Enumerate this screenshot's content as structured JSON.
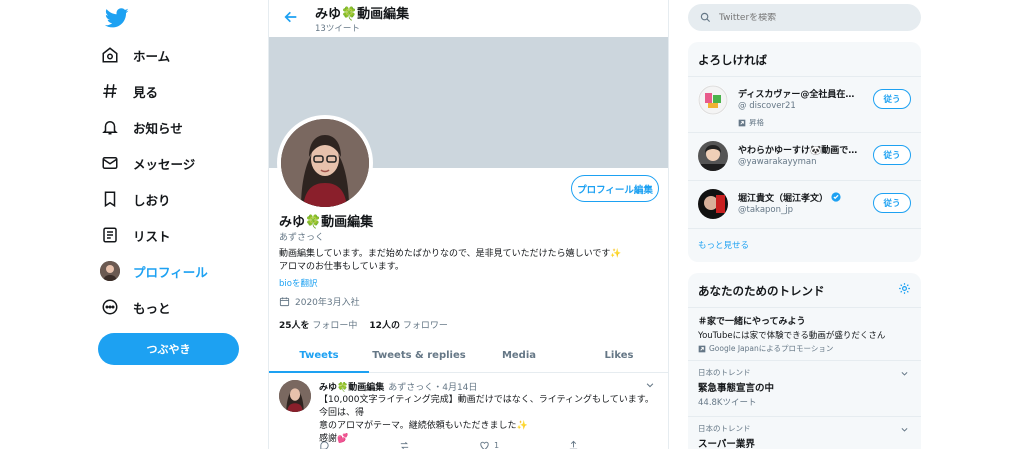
{
  "nav": {
    "items": [
      {
        "label": "ホーム",
        "icon": "home-icon"
      },
      {
        "label": "見る",
        "icon": "hashtag-icon"
      },
      {
        "label": "お知らせ",
        "icon": "bell-icon"
      },
      {
        "label": "メッセージ",
        "icon": "mail-icon"
      },
      {
        "label": "しおり",
        "icon": "bookmark-icon"
      },
      {
        "label": "リスト",
        "icon": "list-icon"
      },
      {
        "label": "プロフィール",
        "icon": "avatar"
      },
      {
        "label": "もっと",
        "icon": "more-circle-icon"
      }
    ],
    "tweet_button": "つぶやき"
  },
  "header": {
    "name": "みゆ🍀動画編集",
    "tweet_count": "13ツイート"
  },
  "profile": {
    "edit_button": "プロフィール編集",
    "name": "みゆ🍀動画編集",
    "handle": "あずさっく",
    "bio_line1": "動画編集しています。まだ始めたばかりなので、是非見ていただけたら嬉しいです✨",
    "bio_line2": "アロマのお仕事もしています。",
    "translate": "bioを翻訳",
    "joined": "2020年3月入社",
    "following_count": "25人を",
    "following_label": "フォロー中",
    "followers_count": "12人の",
    "followers_label": "フォロワー"
  },
  "tabs": [
    "Tweets",
    "Tweets & replies",
    "Media",
    "Likes"
  ],
  "tweet": {
    "name": "みゆ🍀動画編集",
    "handle_date": "あずさっく・4月14日",
    "line1": "【10,000文字ライティング完成】動画だけではなく、ライティングもしています。今回は、得",
    "line2": "意のアロマがテーマ。継続依頼もいただきました✨",
    "line3": "感謝💕",
    "like_count": "1"
  },
  "search": {
    "placeholder": "Twitterを検索"
  },
  "who_to_follow": {
    "title": "よろしければ",
    "users": [
      {
        "name": "ディスカヴァー@全社員在宅...",
        "handle": "@ discover21",
        "promo": "昇格",
        "button": "従う"
      },
      {
        "name": "やわらかゆーすけ🐼動画で人...",
        "handle": "@yawarakayyman",
        "button": "従う"
      },
      {
        "name": "堀江貴文（堀江孝文）",
        "handle": "@takapon_jp",
        "button": "従う"
      }
    ],
    "more": "もっと見せる"
  },
  "trends": {
    "title": "あなたのためのトレンド",
    "items": [
      {
        "name": "＃家で一緒にやってみよう",
        "desc": "YouTubeには家で体験できる動画が盛りだくさん",
        "promo": "Google Japanによるプロモーション"
      },
      {
        "category": "日本のトレンド",
        "name": "緊急事態宣言の中",
        "sub": "44.8Kツイート"
      },
      {
        "category": "日本のトレンド",
        "name": "スーパー業界"
      }
    ]
  },
  "colors": {
    "accent": "#1da1f2",
    "banner": "#ccd6dd",
    "muted": "#657786",
    "panel": "#f5f8fa"
  }
}
